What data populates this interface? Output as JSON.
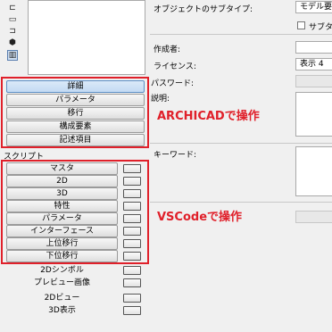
{
  "left": {
    "icons": [
      "expand-icon",
      "window-icon",
      "shrink-icon",
      "cube-icon",
      "gallery-icon"
    ],
    "details_buttons": [
      "詳細",
      "パラメータ",
      "移行",
      "構成要素",
      "記述項目"
    ],
    "script_label": "スクリプト",
    "script_buttons": [
      "マスタ",
      "2D",
      "3D",
      "特性",
      "パラメータ",
      "インターフェース",
      "上位移行",
      "下位移行"
    ],
    "extra_buttons": [
      "2Dシンボル",
      "プレビュー画像"
    ],
    "view_buttons": [
      "2Dビュー",
      "3D表示"
    ]
  },
  "annotations": {
    "archicad": "ARCHICADで操作",
    "vscode": "VSCodeで操作"
  },
  "right": {
    "subtype_label": "オブジェクトのサブタイプ:",
    "subtype_value": "モデル要",
    "subtype_checkbox_label": "サブタ",
    "author_label": "作成者:",
    "license_label": "ライセンス:",
    "license_value": "表示 4",
    "password_label": "パスワード:",
    "description_label": "説明:",
    "keyword_label": "キーワード:"
  },
  "colors": {
    "annotation_red": "#e0202a",
    "selected_blue": "#c3daf3"
  }
}
